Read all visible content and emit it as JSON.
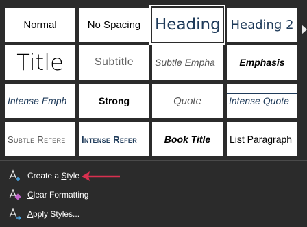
{
  "styles": [
    {
      "label": "Normal"
    },
    {
      "label": "No Spacing"
    },
    {
      "label": "Heading"
    },
    {
      "label": "Heading 2"
    },
    {
      "label": "Title"
    },
    {
      "label": "Subtitle"
    },
    {
      "label": "Subtle Empha"
    },
    {
      "label": "Emphasis"
    },
    {
      "label": "Intense Emph"
    },
    {
      "label": "Strong"
    },
    {
      "label": "Quote"
    },
    {
      "label": "Intense Quote"
    },
    {
      "label": "Subtle Refere"
    },
    {
      "label": "Intense Refer"
    },
    {
      "label": "Book Title"
    },
    {
      "label": "List Paragraph"
    }
  ],
  "menu": {
    "create_style": {
      "pre": "Create a ",
      "u": "S",
      "post": "tyle"
    },
    "clear_formatting": {
      "pre": "",
      "u": "C",
      "post": "lear Formatting"
    },
    "apply_styles": {
      "pre": "",
      "u": "A",
      "post": "pply Styles..."
    }
  },
  "icons": {
    "create_style": "style-add-icon",
    "clear_formatting": "clear-formatting-icon",
    "apply_styles": "apply-styles-icon",
    "gallery_more": "scroll-right-arrow-icon",
    "annotation": "red-arrow-annotation"
  },
  "colors": {
    "background": "#2b2b2b",
    "heading_blue": "#1f3b5a",
    "annotation_red": "#d9304f"
  }
}
